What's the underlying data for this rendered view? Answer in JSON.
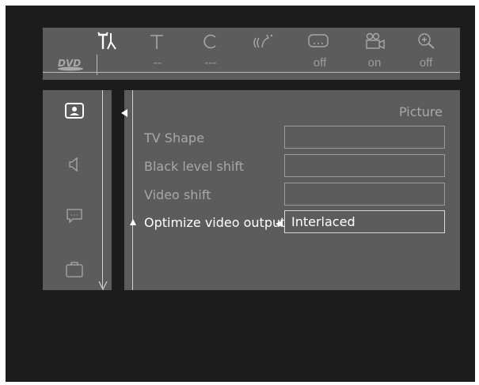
{
  "topbar": {
    "icons": [
      {
        "name": "setup-tools-icon",
        "active": true
      },
      {
        "name": "title-icon",
        "active": false
      },
      {
        "name": "chapter-icon",
        "active": false
      },
      {
        "name": "audio-language-icon",
        "active": false
      },
      {
        "name": "subtitle-icon",
        "active": false
      },
      {
        "name": "camera-angle-icon",
        "active": false
      },
      {
        "name": "zoom-icon",
        "active": false
      }
    ],
    "values": [
      "--",
      "---",
      "off",
      "on",
      "off"
    ],
    "logo": "DVD"
  },
  "sidebar": {
    "items": [
      {
        "name": "picture-icon",
        "active": true
      },
      {
        "name": "sound-icon",
        "active": false
      },
      {
        "name": "language-icon",
        "active": false
      },
      {
        "name": "features-icon",
        "active": false
      }
    ]
  },
  "panel": {
    "title": "Picture",
    "rows": [
      {
        "label": "TV Shape",
        "value": "",
        "active": false
      },
      {
        "label": "Black level shift",
        "value": "",
        "active": false
      },
      {
        "label": "Video shift",
        "value": "",
        "active": false
      },
      {
        "label": "Optimize video output",
        "value": "Interlaced",
        "active": true
      }
    ]
  },
  "colors": {
    "background": "#1c1c1c",
    "panel": "#5c5c5c",
    "inactive_text": "#a8a8a8",
    "active_text": "#ffffff"
  }
}
